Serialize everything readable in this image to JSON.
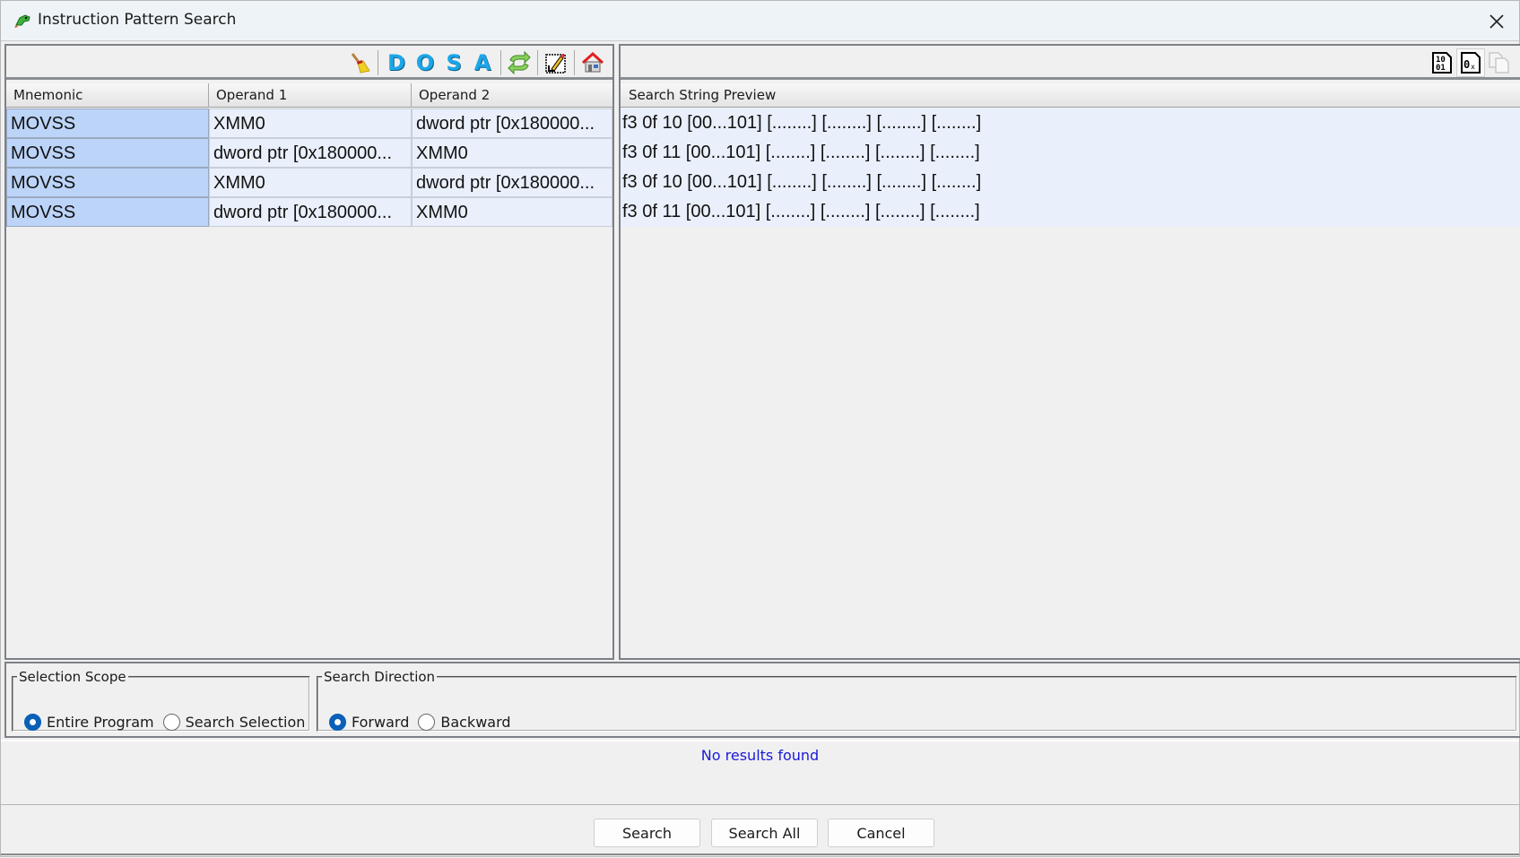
{
  "window": {
    "title": "Instruction Pattern Search",
    "app_icon": "ghidra-dragon-icon",
    "close_icon": "close-icon"
  },
  "left_toolbar": {
    "buttons": [
      {
        "name": "clear-icon",
        "tooltip": "Clear"
      },
      {
        "name": "mask-data-button",
        "label": "D"
      },
      {
        "name": "mask-operands-button",
        "label": "O"
      },
      {
        "name": "mask-scalars-button",
        "label": "S"
      },
      {
        "name": "mask-addresses-button",
        "label": "A"
      },
      {
        "name": "reload-icon"
      },
      {
        "name": "manual-entry-icon"
      },
      {
        "name": "go-home-icon"
      }
    ]
  },
  "right_toolbar": {
    "buttons": [
      {
        "name": "binary-view-icon",
        "label": "10 01"
      },
      {
        "name": "hex-view-icon",
        "label": "0x"
      },
      {
        "name": "copy-icon",
        "disabled": true
      }
    ]
  },
  "instruction_table": {
    "columns": [
      "Mnemonic",
      "Operand 1",
      "Operand 2"
    ],
    "rows": [
      [
        "MOVSS",
        "XMM0",
        "dword ptr [0x180000..."
      ],
      [
        "MOVSS",
        "dword ptr [0x180000...",
        "XMM0"
      ],
      [
        "MOVSS",
        "XMM0",
        "dword ptr [0x180000..."
      ],
      [
        "MOVSS",
        "dword ptr [0x180000...",
        "XMM0"
      ]
    ]
  },
  "preview": {
    "header": "Search String Preview",
    "rows": [
      "f3 0f 10 [00...101] [........] [........] [........] [........]",
      "f3 0f 11 [00...101] [........] [........] [........] [........]",
      "f3 0f 10 [00...101] [........] [........] [........] [........]",
      "f3 0f 11 [00...101] [........] [........] [........] [........]"
    ]
  },
  "selection_scope": {
    "legend": "Selection Scope",
    "options": [
      "Entire Program",
      "Search Selection"
    ],
    "selected": "Entire Program"
  },
  "search_direction": {
    "legend": "Search Direction",
    "options": [
      "Forward",
      "Backward"
    ],
    "selected": "Forward"
  },
  "status": {
    "message": "No results found",
    "color": "#1a1ad8"
  },
  "buttons": {
    "search": "Search",
    "search_all": "Search All",
    "cancel": "Cancel"
  },
  "colors": {
    "selected_cell": "#bcd4f8",
    "row_bg": "#e9f0fb",
    "accent": "#0a5fb8"
  }
}
